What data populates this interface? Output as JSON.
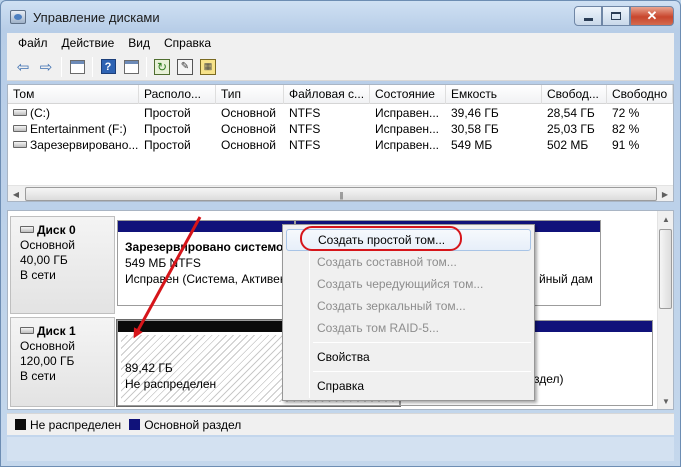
{
  "window": {
    "title": "Управление дисками"
  },
  "menu": [
    "Файл",
    "Действие",
    "Вид",
    "Справка"
  ],
  "volume_list": {
    "columns": [
      "Том",
      "Располо...",
      "Тип",
      "Файловая с...",
      "Состояние",
      "Емкость",
      "Свобод...",
      "Свободно"
    ],
    "rows": [
      {
        "name": "(C:)",
        "layout": "Простой",
        "type": "Основной",
        "fs": "NTFS",
        "state": "Исправен...",
        "capacity": "39,46 ГБ",
        "free": "28,54 ГБ",
        "free_pct": "72 %"
      },
      {
        "name": "Entertainment (F:)",
        "layout": "Простой",
        "type": "Основной",
        "fs": "NTFS",
        "state": "Исправен...",
        "capacity": "30,58 ГБ",
        "free": "25,03 ГБ",
        "free_pct": "82 %"
      },
      {
        "name": "Зарезервировано...",
        "layout": "Простой",
        "type": "Основной",
        "fs": "NTFS",
        "state": "Исправен...",
        "capacity": "549 МБ",
        "free": "502 МБ",
        "free_pct": "91 %"
      }
    ]
  },
  "disks": [
    {
      "name": "Диск 0",
      "kind": "Основной",
      "size": "40,00 ГБ",
      "status": "В сети",
      "partitions": [
        {
          "title": "Зарезервировано системой",
          "size": "549 МБ NTFS",
          "status": "Исправен (Система, Активен"
        },
        {
          "tail": "йный дам"
        }
      ]
    },
    {
      "name": "Диск 1",
      "kind": "Основной",
      "size": "120,00 ГБ",
      "status": "В сети",
      "partitions": [
        {
          "size": "89,42 ГБ",
          "status": "Не распределен"
        },
        {
          "tail": "здел)"
        }
      ]
    }
  ],
  "legend": [
    {
      "label": "Не распределен",
      "color": "#0a0a0a"
    },
    {
      "label": "Основной раздел",
      "color": "#10127a"
    }
  ],
  "context_menu": {
    "items": [
      {
        "label": "Создать простой том...",
        "enabled": true
      },
      {
        "label": "Создать составной том...",
        "enabled": false
      },
      {
        "label": "Создать чередующийся том...",
        "enabled": false
      },
      {
        "label": "Создать зеркальный том...",
        "enabled": false
      },
      {
        "label": "Создать том RAID-5...",
        "enabled": false
      },
      {
        "label": "Свойства",
        "enabled": true
      },
      {
        "label": "Справка",
        "enabled": true
      }
    ]
  },
  "accent_colors": {
    "highlight_ring": "#d6151a",
    "primary_partition": "#10127a",
    "unallocated": "#0a0a0a"
  },
  "icons": [
    "back-arrow-icon",
    "forward-arrow-icon",
    "console-tree-icon",
    "help-icon",
    "show-action-pane-icon",
    "refresh-icon",
    "properties-icon",
    "rescan-icon",
    "drive-icon"
  ]
}
